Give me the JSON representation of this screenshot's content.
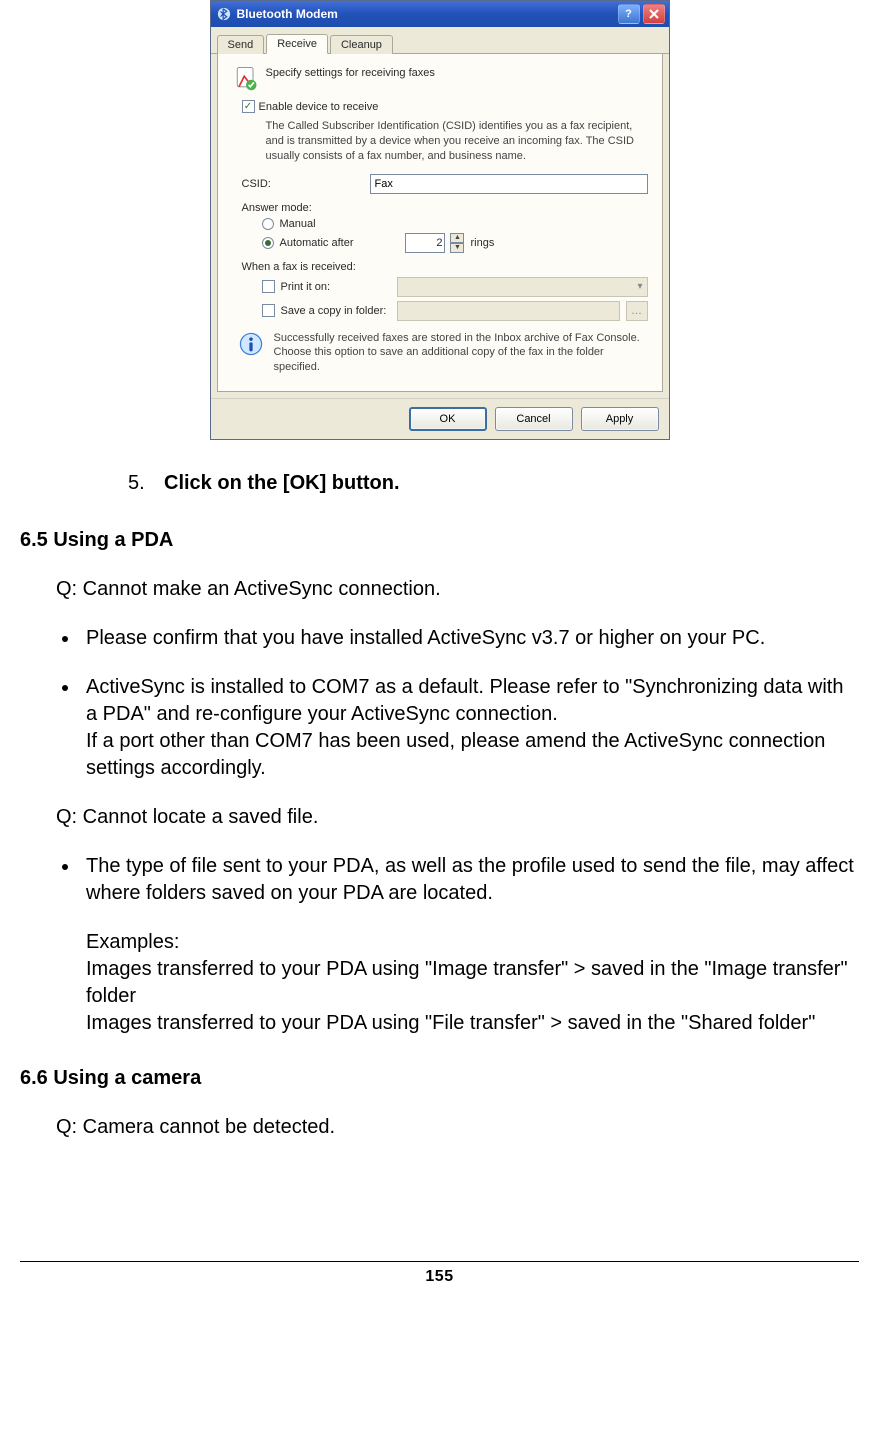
{
  "dialog": {
    "title": "Bluetooth Modem",
    "tabs": [
      {
        "label": "Send",
        "active": false
      },
      {
        "label": "Receive",
        "active": true
      },
      {
        "label": "Cleanup",
        "active": false
      }
    ],
    "section_heading": "Specify settings for receiving faxes",
    "enable_checkbox": {
      "checked": true,
      "label": "Enable device to receive"
    },
    "csid_desc": "The Called Subscriber Identification (CSID) identifies you as a fax recipient, and is transmitted by a device when you receive an incoming fax. The CSID usually consists of a fax number, and business name.",
    "csid_label": "CSID:",
    "csid_value": "Fax",
    "answer_mode_label": "Answer mode:",
    "answer_manual": {
      "selected": false,
      "label": "Manual"
    },
    "answer_auto": {
      "selected": true,
      "label": "Automatic after",
      "rings_value": "2",
      "rings_suffix": "rings"
    },
    "when_received_label": "When a fax is received:",
    "print_row": {
      "checked": false,
      "label": "Print it on:"
    },
    "save_row": {
      "checked": false,
      "label": "Save a copy in folder:"
    },
    "info_text": "Successfully received faxes are stored in the Inbox archive of Fax Console. Choose this option to save an additional copy of the fax in the folder specified.",
    "buttons": {
      "ok": "OK",
      "cancel": "Cancel",
      "apply": "Apply"
    }
  },
  "doc": {
    "step5_num": "5.",
    "step5_text": "Click on the [OK] button.",
    "sec65": "6.5  Using a PDA",
    "q1": "Q: Cannot make an ActiveSync connection.",
    "b1": "Please confirm that you have installed ActiveSync v3.7 or higher on your PC.",
    "b2a": "ActiveSync is installed to COM7 as a default. Please refer to \"Synchronizing data with a PDA\" and re-configure your ActiveSync connection.",
    "b2b": "If a port other than COM7 has been used, please amend the ActiveSync connection settings accordingly.",
    "q2": "Q: Cannot locate a saved file.",
    "b3a": "The type of file sent to your PDA, as well as the profile used to send the file, may affect where folders saved on your PDA are located.",
    "b3_examples_label": "Examples:",
    "b3_ex1": "Images transferred to your PDA using \"Image transfer\" > saved in the \"Image transfer\" folder",
    "b3_ex2": "Images transferred to your PDA using \"File transfer\" > saved in the \"Shared folder\"",
    "sec66": "6.6  Using a camera",
    "q3": "Q: Camera cannot be detected.",
    "page_number": "155"
  }
}
